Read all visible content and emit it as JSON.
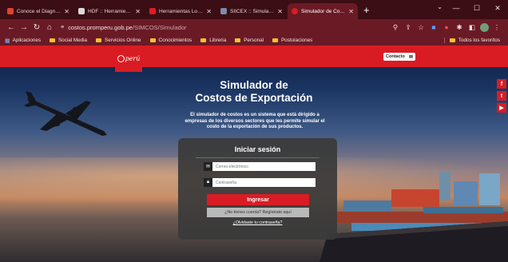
{
  "browser": {
    "tabs": [
      {
        "label": "Conoce el Diagnóstico P",
        "favicon_color": "#e0452b"
      },
      {
        "label": "HDF :: Herramienta de D",
        "favicon_color": "#d9d9d9"
      },
      {
        "label": "Herramientas Logísticas",
        "favicon_color": "#d91c24"
      },
      {
        "label": "SIICEX :: Simulador de R",
        "favicon_color": "#7f8aa8"
      },
      {
        "label": "Simulador de Costos - P",
        "favicon_color": "#d91c24",
        "active": true
      }
    ],
    "new_tab": "+",
    "window_controls": {
      "minimize": "—",
      "maximize": "☐",
      "close": "✕"
    },
    "tab_menu": "⌄",
    "url_host": "costos.promperu.gob.pe",
    "url_path": "/SIMCOS/Simulador",
    "bookmarks": [
      "Aplicaciones",
      "Social Media",
      "Servicios Online",
      "Conocimientos",
      "Libreria",
      "Personal",
      "Postulaciones"
    ],
    "bookmarks_right": "Todos los favoritos"
  },
  "page": {
    "logo_text": "perú",
    "contact_label": "Contacto",
    "title_line1": "Simulador de",
    "title_line2": "Costos de Exportación",
    "description": "El simulador de costos es un sistema que está dirigido a empresas de los diversos sectores que les permite simular el costo de la exportación de sus productos.",
    "social": [
      {
        "name": "facebook",
        "glyph": "f"
      },
      {
        "name": "twitter",
        "glyph": "t"
      },
      {
        "name": "youtube",
        "glyph": "▶"
      }
    ],
    "login": {
      "title": "Iniciar sesión",
      "email_placeholder": "Correo electrónico",
      "password_placeholder": "Contraseña",
      "submit_label": "Ingresar",
      "register_label": "¿No tienes cuenta? Regístrate aquí",
      "forgot_label": "¿Olvidaste tu contraseña?"
    }
  },
  "colors": {
    "brand_red": "#d91c24",
    "chrome": "#6a1a24",
    "tabbar": "#3b0d14"
  }
}
